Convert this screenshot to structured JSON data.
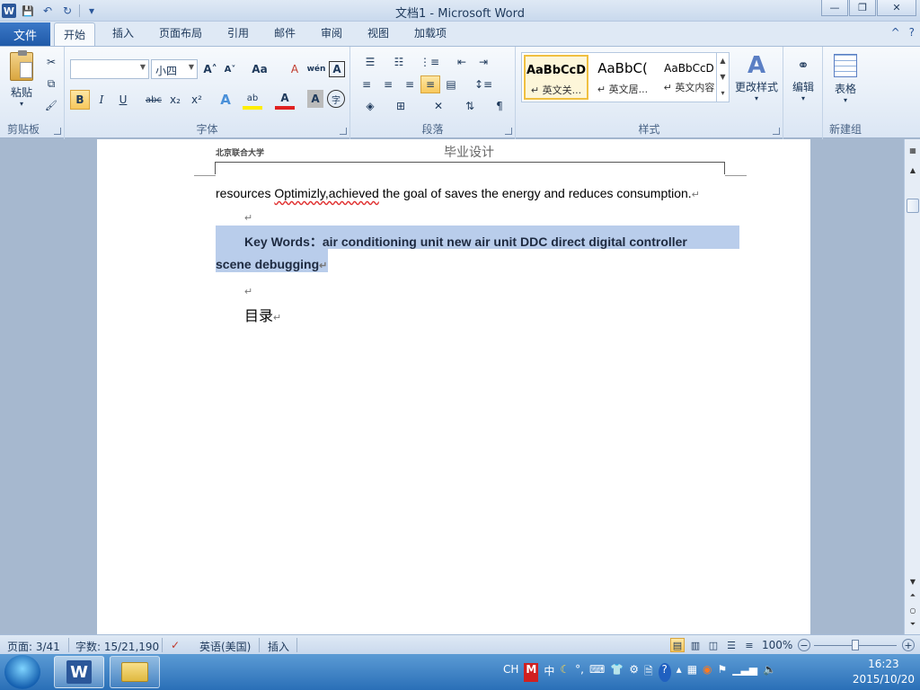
{
  "window": {
    "title": "文档1  -  Microsoft Word",
    "min": "—",
    "max": "❐",
    "close": "✕"
  },
  "quick_access": {
    "logo": "W",
    "save": "💾",
    "undo": "↶",
    "redo": "↻",
    "customize": "▾"
  },
  "tabs": {
    "file": "文件",
    "items": [
      "开始",
      "插入",
      "页面布局",
      "引用",
      "邮件",
      "审阅",
      "视图",
      "加载项"
    ],
    "active_index": 0,
    "help": "?",
    "collapse": "^"
  },
  "ribbon": {
    "clipboard": {
      "label": "剪贴板",
      "paste": "粘贴",
      "cut": "✂",
      "copy": "⧉",
      "format_painter": "🖌"
    },
    "font": {
      "label": "字体",
      "font_name": "",
      "font_size": "小四",
      "grow": "A˄",
      "shrink": "A˅",
      "change_case": "Aa",
      "clear": "A",
      "phonetic": "wén",
      "border": "A",
      "bold": "B",
      "italic": "I",
      "underline": "U",
      "strike": "abc",
      "subscript": "x₂",
      "superscript": "x²",
      "effects": "A",
      "highlight": "ab",
      "color": "A",
      "shading": "A",
      "enclose": "字"
    },
    "paragraph": {
      "label": "段落"
    },
    "styles": {
      "label": "样式",
      "items": [
        {
          "sample": "AaBbCcD",
          "name": "↵ 英文关..."
        },
        {
          "sample": "AaBbC(",
          "name": "↵ 英文居..."
        },
        {
          "sample": "AaBbCcD",
          "name": "↵ 英文内容"
        }
      ],
      "change": "更改样式"
    },
    "editing": {
      "label": "编辑"
    },
    "new_group": {
      "label": "新建组",
      "table": "表格"
    }
  },
  "document": {
    "header_left": "北京联合大学",
    "header_center": "毕业设计",
    "line1_a": "resources ",
    "line1_err": "Optimizly,achieved",
    "line1_b": " the goal of saves the energy and reduces consumption.",
    "keywords_line1": "Key Words：air conditioning unit    new air unit    DDC      direct digital controller",
    "keywords_line2": "scene debugging",
    "toc": "目录",
    "para_mark": "↵"
  },
  "statusbar": {
    "page": "页面: 3/41",
    "words": "字数: 15/21,190",
    "language": "英语(美国)",
    "mode": "插入",
    "zoom": "100%",
    "zoom_minus": "−",
    "zoom_plus": "+",
    "zoom_level": 0.5
  },
  "taskbar": {
    "tray_items": [
      "CH",
      "M",
      "中",
      "☾",
      "°,",
      "⌨",
      "👕",
      "⚙",
      "🗎",
      "?"
    ],
    "time": "16:23",
    "date": "2015/10/20"
  },
  "colors": {
    "ribbon_accent": "#2b579a",
    "selection": "#b9cdeb",
    "file_tab": "#1f5aa8"
  }
}
